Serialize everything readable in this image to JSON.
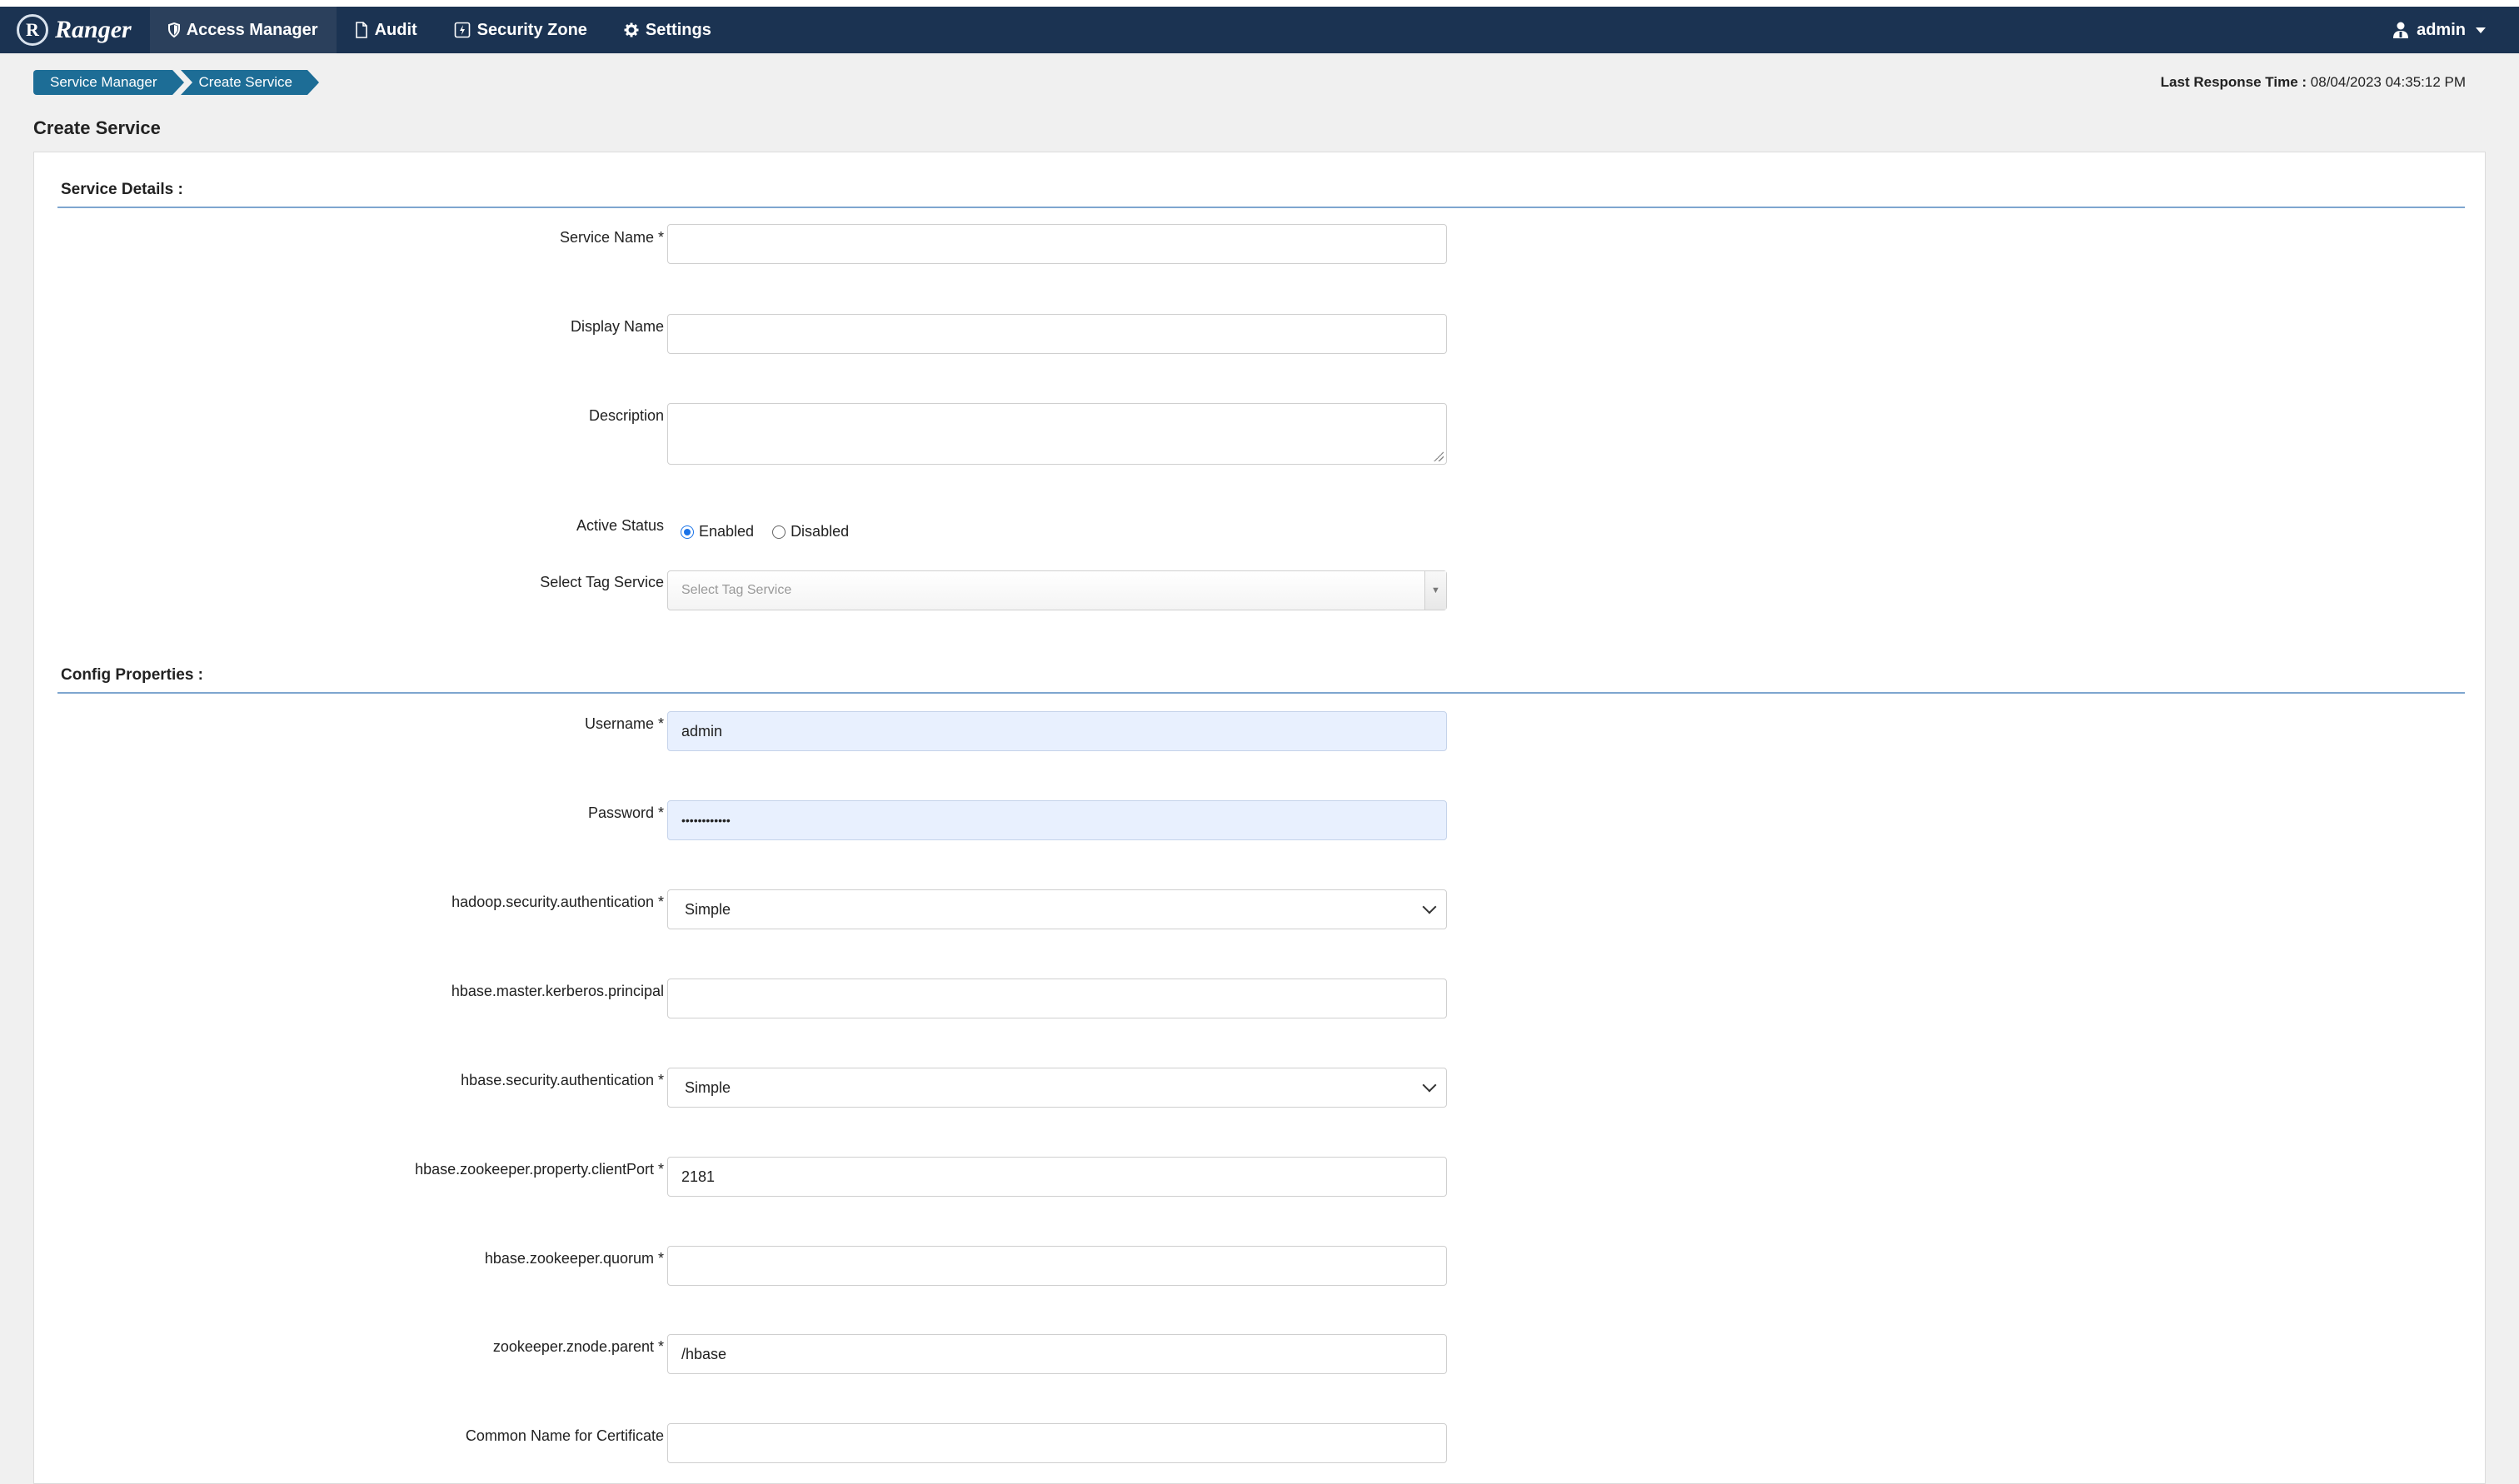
{
  "nav": {
    "brand": "Ranger",
    "brand_mark": "R",
    "items": [
      {
        "label": "Access Manager",
        "icon": "shield-icon"
      },
      {
        "label": "Audit",
        "icon": "file-icon"
      },
      {
        "label": "Security Zone",
        "icon": "zone-icon"
      },
      {
        "label": "Settings",
        "icon": "gear-icon"
      }
    ],
    "user": "admin"
  },
  "breadcrumb": [
    "Service Manager",
    "Create Service"
  ],
  "last_response": {
    "label": "Last Response Time :",
    "value": "08/04/2023 04:35:12 PM"
  },
  "page_title": "Create Service",
  "service_details": {
    "title": "Service Details :",
    "service_name_label": "Service Name *",
    "display_name_label": "Display Name",
    "description_label": "Description",
    "active_status_label": "Active Status",
    "enabled_label": "Enabled",
    "disabled_label": "Disabled",
    "tag_service_label": "Select Tag Service",
    "tag_service_placeholder": "Select Tag Service"
  },
  "config": {
    "title": "Config Properties :",
    "fields": [
      {
        "label": "Username *",
        "value": "admin"
      },
      {
        "label": "Password *",
        "value": "••••••••••••"
      },
      {
        "label": "hadoop.security.authentication *",
        "value": "Simple"
      },
      {
        "label": "hbase.master.kerberos.principal",
        "value": ""
      },
      {
        "label": "hbase.security.authentication *",
        "value": "Simple"
      },
      {
        "label": "hbase.zookeeper.property.clientPort *",
        "value": "2181"
      },
      {
        "label": "hbase.zookeeper.quorum *",
        "value": ""
      },
      {
        "label": "zookeeper.znode.parent *",
        "value": "/hbase"
      },
      {
        "label": "Common Name for Certificate",
        "value": ""
      }
    ]
  }
}
